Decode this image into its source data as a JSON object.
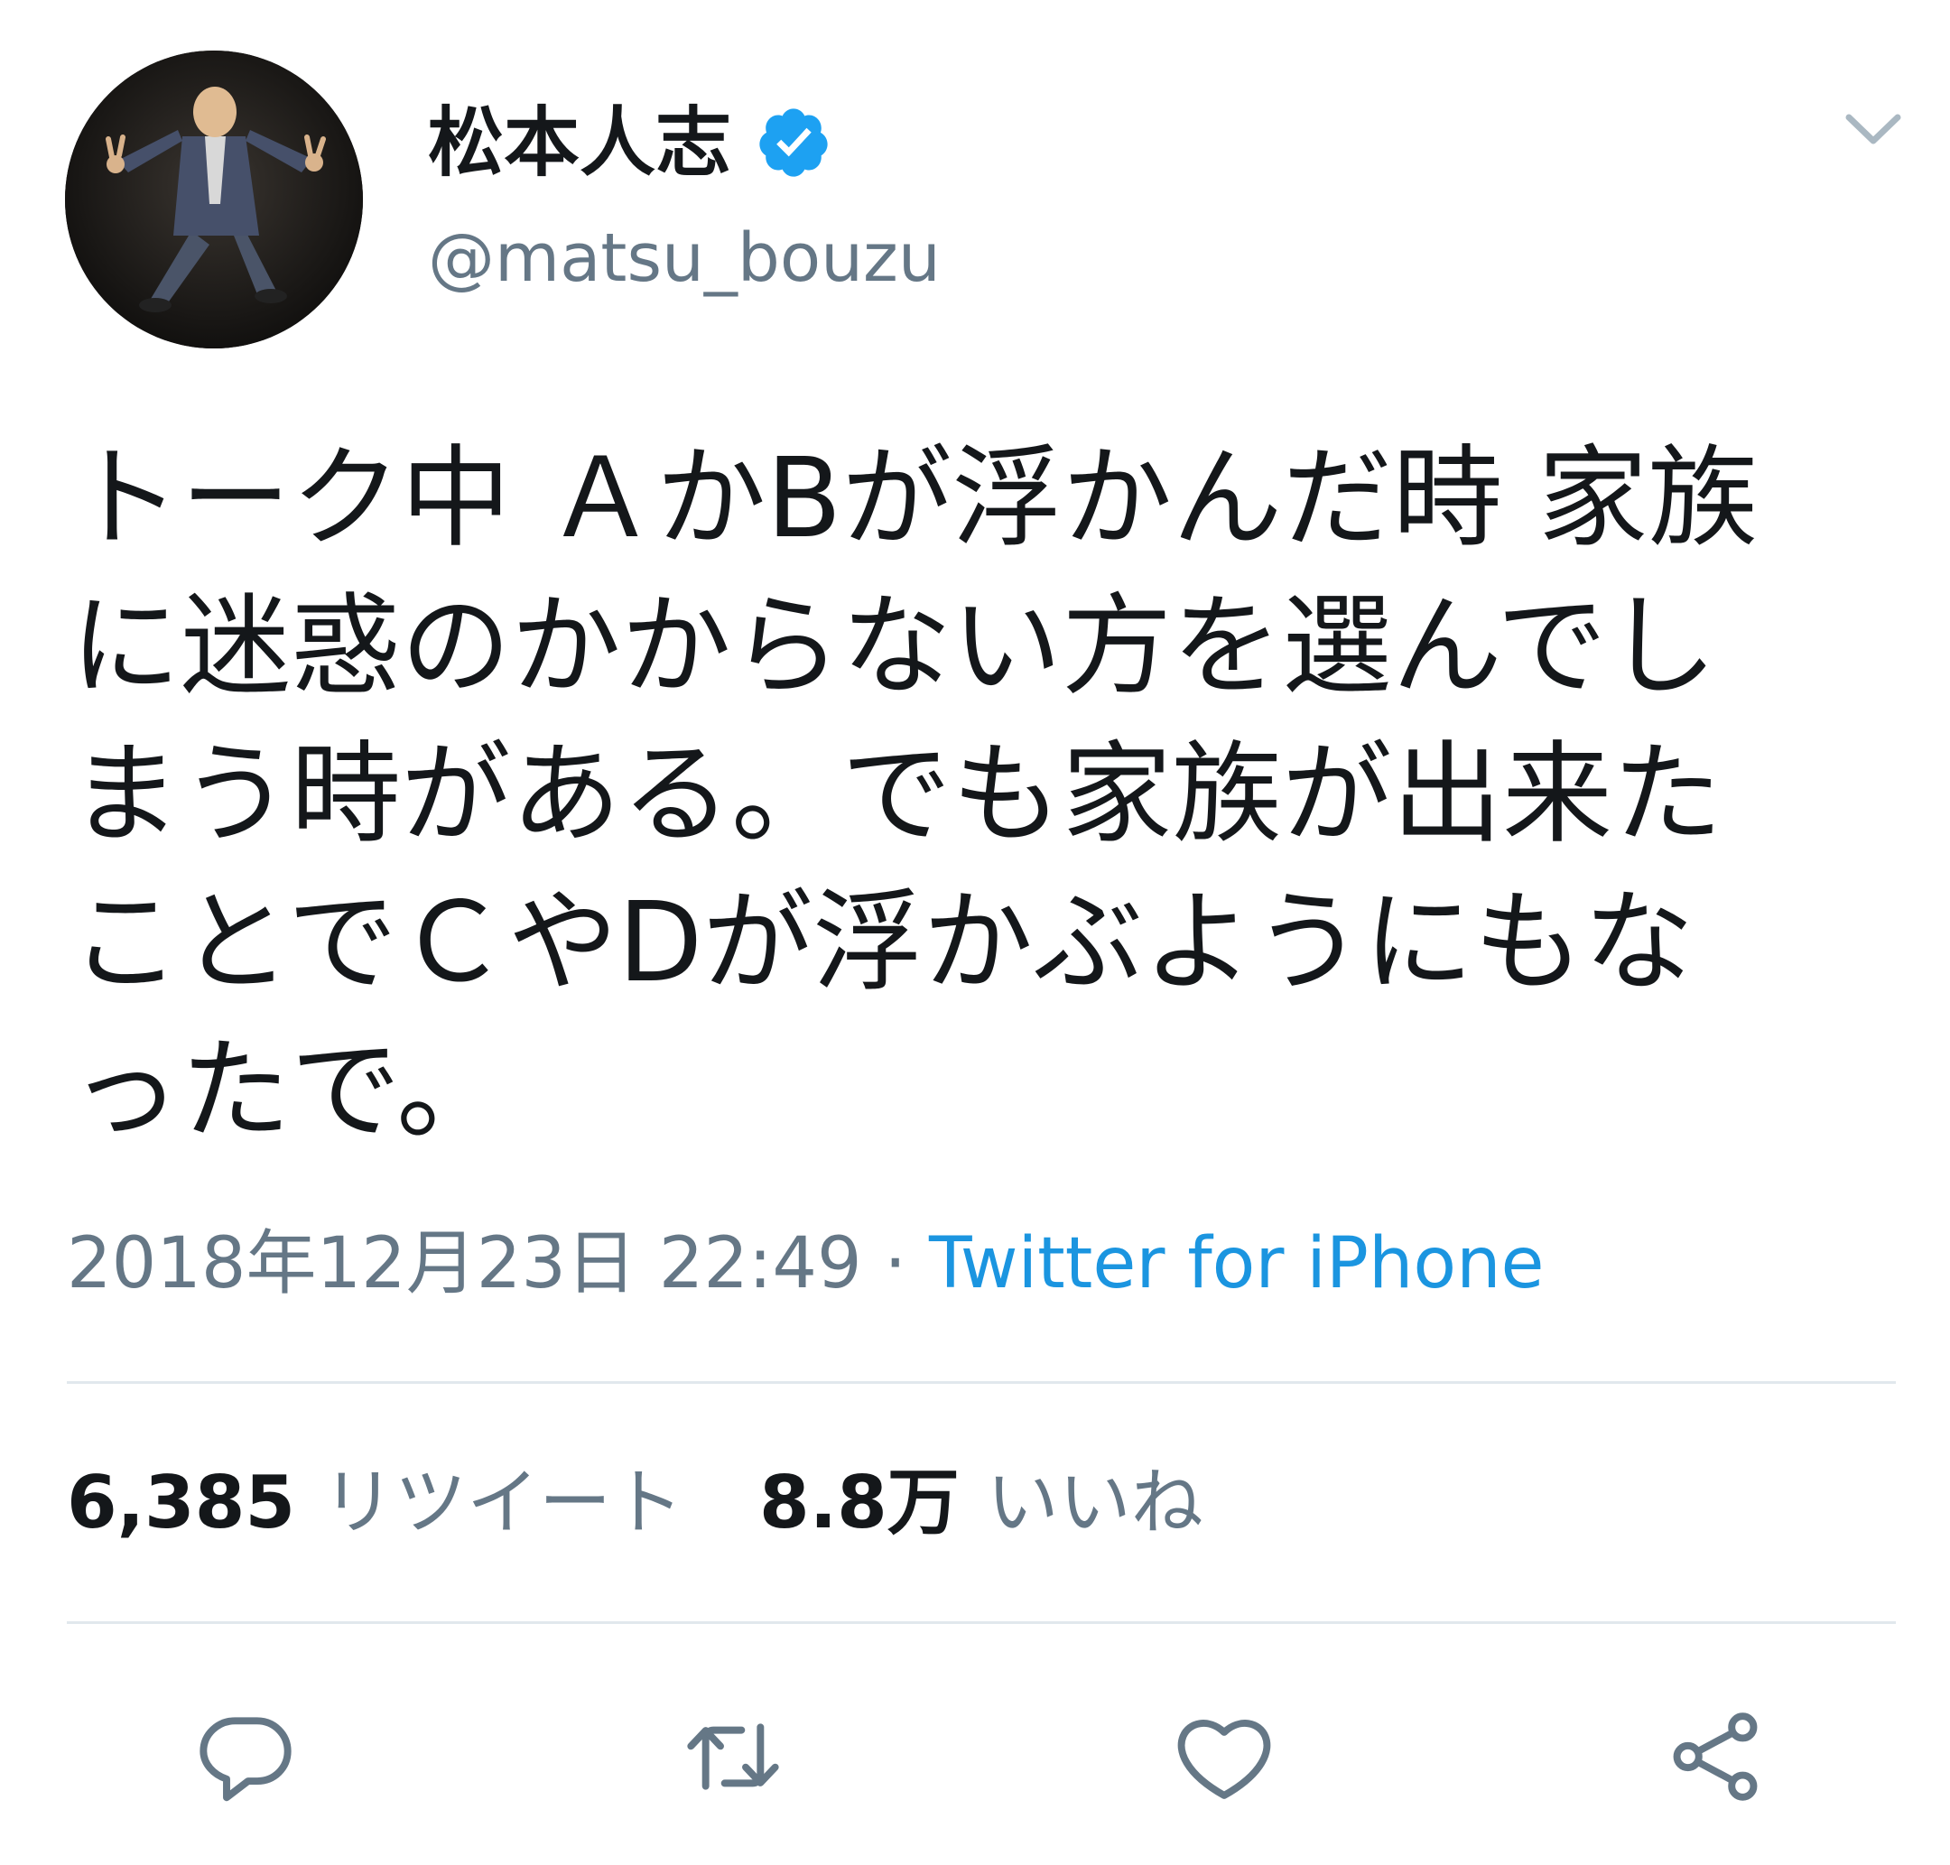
{
  "user": {
    "display_name": "松本人志",
    "handle": "@matsu_bouzu",
    "verified": true
  },
  "tweet": {
    "text": "トーク中 ＡかBが浮かんだ時 家族\nに迷惑のかからない方を選んでし\nまう時がある。でも家族が出来た\nことでＣやDが浮かぶようにもな\nったで。",
    "timestamp": "2018年12月23日 22:49",
    "separator": " · ",
    "source": "Twitter for iPhone"
  },
  "stats": {
    "retweet_count": "6,385",
    "retweet_label": "リツイート",
    "like_count": "8.8万",
    "like_label": "いいね"
  },
  "actions": {
    "icons": [
      "reply-icon",
      "retweet-icon",
      "like-icon",
      "share-icon"
    ]
  },
  "colors": {
    "text": "#14171a",
    "secondary": "#657786",
    "link": "#1b95e0",
    "verified": "#1da1f2",
    "divider": "#e1e8ed",
    "icon": "#657786"
  }
}
